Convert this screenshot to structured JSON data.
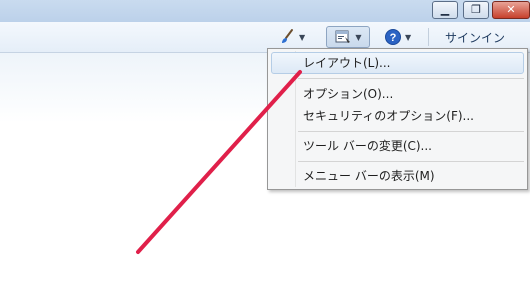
{
  "toolbar": {
    "signin_label": "サインイン"
  },
  "menu": {
    "items": [
      {
        "label": "レイアウト(L)..."
      },
      {
        "label": "オプション(O)..."
      },
      {
        "label": "セキュリティのオプション(F)..."
      },
      {
        "label": "ツール バーの変更(C)..."
      },
      {
        "label": "メニュー バーの表示(M)"
      }
    ]
  },
  "icons": {
    "window_minimize": "minimize-icon",
    "window_maximize": "maximize-icon",
    "window_close": "close-icon",
    "paint": "paintbrush-icon",
    "tools": "tools-icon",
    "help": "help-icon"
  },
  "colors": {
    "annotation_arrow": "#e0204a",
    "help_icon": "#2b63c4"
  }
}
